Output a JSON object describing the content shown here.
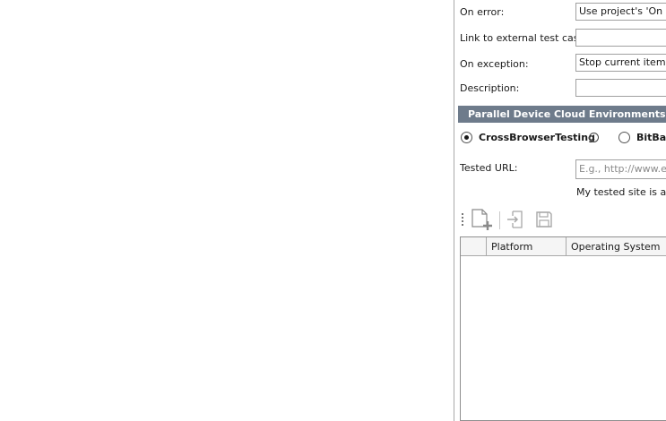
{
  "form": {
    "on_error": {
      "label": "On error:",
      "value": "Use project's 'On err"
    },
    "link_external": {
      "label": "Link to external test case:",
      "value": ""
    },
    "on_exception": {
      "label": "On exception:",
      "value": "Stop current item"
    },
    "description": {
      "label": "Description:",
      "value": ""
    }
  },
  "section": {
    "title": "Parallel Device Cloud Environments"
  },
  "providers": [
    {
      "label": "CrossBrowserTesting",
      "selected": true
    },
    {
      "label": "BitBar",
      "selected": false
    }
  ],
  "tested_url": {
    "label": "Tested URL:",
    "placeholder": "E.g., http://www.ex",
    "hint": "My tested site is ava"
  },
  "toolbar": {
    "icons": [
      "new-environment-icon",
      "import-icon",
      "save-icon"
    ]
  },
  "grid": {
    "columns": [
      "",
      "Platform",
      "Operating System"
    ]
  }
}
